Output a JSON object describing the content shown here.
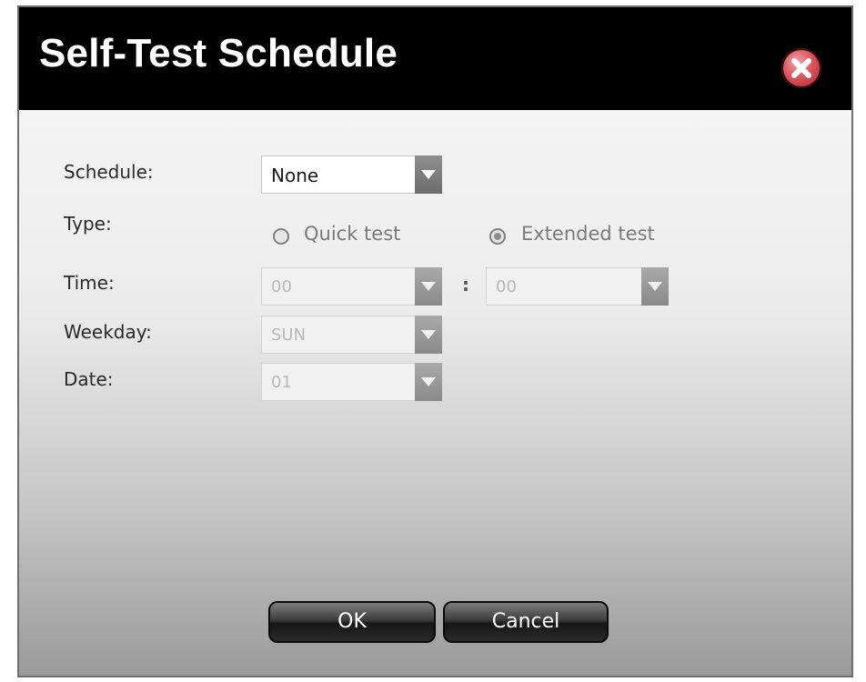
{
  "dialog": {
    "title": "Self-Test Schedule",
    "close_icon": "close-icon"
  },
  "form": {
    "schedule_label": "Schedule:",
    "schedule_value": "None",
    "type_label": "Type:",
    "type_options": [
      {
        "label": "Quick test",
        "selected": false
      },
      {
        "label": "Extended test",
        "selected": true
      }
    ],
    "time_label": "Time:",
    "time_hour_value": "00",
    "time_separator": ":",
    "time_minute_value": "00",
    "weekday_label": "Weekday:",
    "weekday_value": "SUN",
    "date_label": "Date:",
    "date_value": "01"
  },
  "buttons": {
    "ok_label": "OK",
    "cancel_label": "Cancel"
  },
  "colors": {
    "titlebar": "#000000",
    "close_button": "#d9525c",
    "button": "#2a2a2a"
  }
}
